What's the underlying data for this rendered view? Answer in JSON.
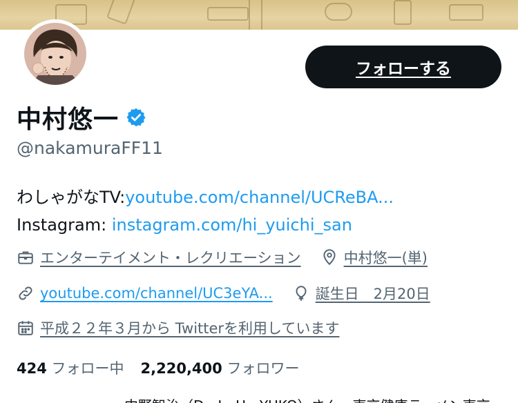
{
  "profile": {
    "follow_label": "フォローする",
    "display_name": "中村悠一",
    "handle": "@nakamuraFF11",
    "bio_prefix_1": "わしゃがなTV:",
    "bio_link_1": "youtube.com/channel/UCReBA...",
    "bio_prefix_2": "Instagram: ",
    "bio_link_2": "instagram.com/hi_yuichi_san",
    "category": "エンターテイメント・レクリエーション",
    "location": "中村悠一(単)",
    "website": "youtube.com/channel/UC3eYA...",
    "birthday": "誕生日　2月20日",
    "joined": "平成２２年３月から Twitterを利用しています",
    "following_count": "424",
    "following_label": "フォロー中",
    "followers_count": "2,220,400",
    "followers_label": "フォロワー",
    "cut_text": "中野智治（D．J．U．YUKO）さん　東京健康ラーメン東京"
  },
  "colors": {
    "link": "#1d9bf0",
    "muted": "#536471",
    "button_bg": "#0f1419",
    "verified": "#1d9bf0"
  }
}
